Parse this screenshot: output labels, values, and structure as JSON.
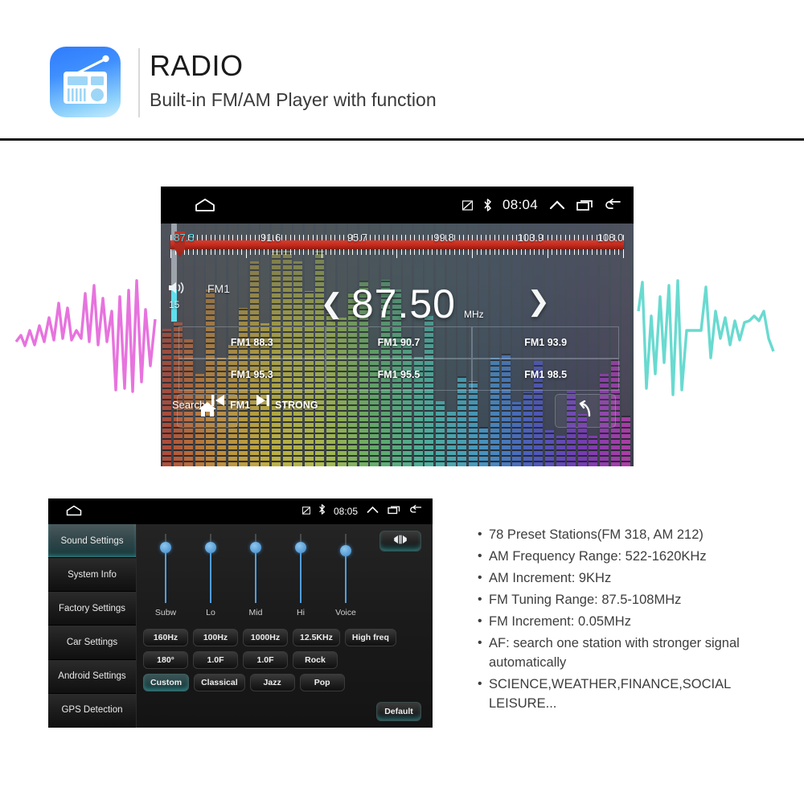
{
  "header": {
    "title": "RADIO",
    "subtitle": "Built-in FM/AM Player with function",
    "icon": "radio-app-icon"
  },
  "radio_screen": {
    "statusbar": {
      "home_icon": "home-icon",
      "signal_icon": "signal-icon",
      "bluetooth_icon": "bluetooth-icon",
      "time": "08:04",
      "expand_icon": "chevron-up-icon",
      "recents_icon": "recents-icon",
      "back_icon": "back-arrow-icon"
    },
    "tuner": {
      "labels": [
        "87.5",
        "91.6",
        "95.7",
        "99.8",
        "103.9",
        "108.0"
      ],
      "active_label": "87.5",
      "pointer_position_percent": 2,
      "scale_min": 87.5,
      "scale_max": 108.0,
      "active_color": "#4fd8e8",
      "bar_color": "#c22a1c"
    },
    "volume": {
      "icon": "volume-icon",
      "value": "15"
    },
    "band_label": "FM1",
    "frequency": {
      "prev_icon": "chevron-left-icon",
      "value": "87.50",
      "unit": "MHz",
      "next_icon": "chevron-right-icon"
    },
    "presets": [
      "FM1 88.3",
      "FM1 90.7",
      "FM1 93.9",
      "FM1 95.3",
      "FM1 95.5",
      "FM1 98.5"
    ],
    "toolbar": {
      "home_icon": "home-icon",
      "search_label": "Search",
      "prev_icon": "skip-previous-icon",
      "band_label": "FM1",
      "next_icon": "skip-next-icon",
      "strong_label": "STRONG",
      "back_icon": "back-arrow-icon"
    }
  },
  "settings_screen": {
    "statusbar": {
      "home_icon": "home-icon",
      "signal_icon": "signal-icon",
      "bluetooth_icon": "bluetooth-icon",
      "time": "08:05",
      "expand_icon": "chevron-up-icon",
      "recents_icon": "recents-icon",
      "back_icon": "back-arrow-icon"
    },
    "sidebar": [
      {
        "label": "Sound Settings",
        "active": true
      },
      {
        "label": "System Info",
        "active": false
      },
      {
        "label": "Factory Settings",
        "active": false
      },
      {
        "label": "Car Settings",
        "active": false
      },
      {
        "label": "Android Settings",
        "active": false
      },
      {
        "label": "GPS Detection",
        "active": false
      }
    ],
    "balance_button_icon": "balance-fader-icon",
    "sliders": [
      {
        "label": "Subw",
        "knob_percent": 20
      },
      {
        "label": "Lo",
        "knob_percent": 20
      },
      {
        "label": "Mid",
        "knob_percent": 20
      },
      {
        "label": "Hi",
        "knob_percent": 20
      },
      {
        "label": "Voice",
        "knob_percent": 24
      }
    ],
    "button_rows": [
      [
        {
          "label": "160Hz",
          "selected": false
        },
        {
          "label": "100Hz",
          "selected": false
        },
        {
          "label": "1000Hz",
          "selected": false
        },
        {
          "label": "12.5KHz",
          "selected": false
        },
        {
          "label": "High freq",
          "selected": false
        }
      ],
      [
        {
          "label": "180°",
          "selected": false
        },
        {
          "label": "1.0F",
          "selected": false
        },
        {
          "label": "1.0F",
          "selected": false
        },
        {
          "label": "Rock",
          "selected": false
        }
      ],
      [
        {
          "label": "Custom",
          "selected": true
        },
        {
          "label": "Classical",
          "selected": false
        },
        {
          "label": "Jazz",
          "selected": false
        },
        {
          "label": "Pop",
          "selected": false
        }
      ]
    ],
    "default_button": "Default"
  },
  "specs": [
    "78 Preset Stations(FM 318, AM 212)",
    "AM Frequency Range: 522-1620KHz",
    "AM Increment: 9KHz",
    "FM Tuning Range: 87.5-108MHz",
    "FM Increment: 0.05MHz",
    "AF: search one station with stronger signal automatically",
    "SCIENCE,WEATHER,FINANCE,SOCIAL LEISURE..."
  ],
  "decoration": {
    "left_waveform_color": "#e040d8",
    "right_waveform_color": "#4fd4c8"
  }
}
